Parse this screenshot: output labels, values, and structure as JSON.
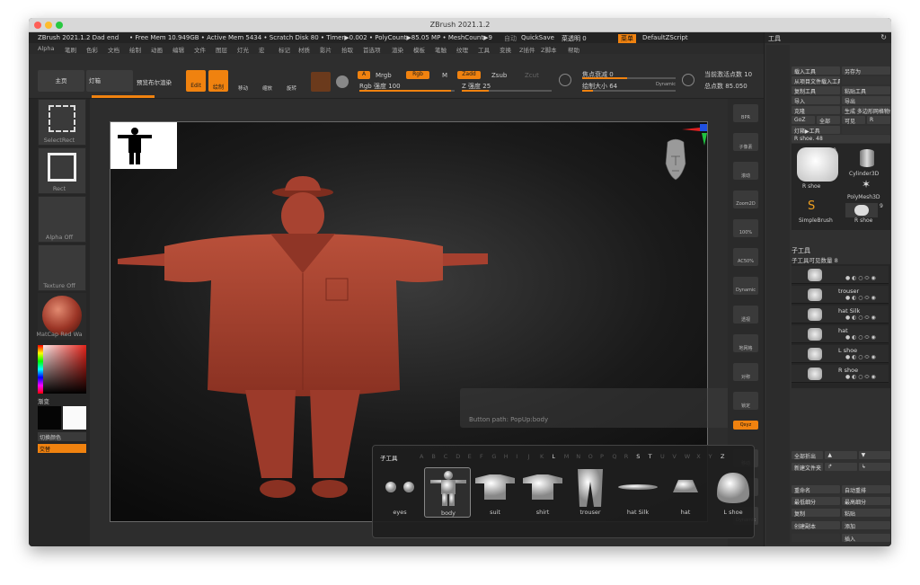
{
  "window": {
    "title": "ZBrush 2021.1.2"
  },
  "status": {
    "items": [
      "ZBrush 2021.1.2 Dad end",
      "• Free Mem 10.949GB • Active Mem 5434 • Scratch Disk 80 • Timer▶0.002 • PolyCount▶85.05 MP • MeshCount▶9"
    ],
    "right": [
      "自动",
      "QuickSave",
      "菜透明 0",
      "菜单",
      "DefaultZScript"
    ]
  },
  "menu": [
    "Alpha",
    "笔刷",
    "色彩",
    "文档",
    "绘制",
    "动画",
    "编辑",
    "文件",
    "图层",
    "灯光",
    "宏",
    "标记",
    "材质",
    "影片",
    "拾取",
    "首选项",
    "渲染",
    "模板",
    "笔触",
    "纹理",
    "工具",
    "变换",
    "Z插件",
    "Z脚本",
    "帮助"
  ],
  "topbar": {
    "home": "主页",
    "lightbox": "灯箱",
    "preview": "预览布尔渲染",
    "edit": "Edit",
    "draw": "绘制",
    "move": "移动",
    "scale": "缩放",
    "rotate": "旋转",
    "a": "A",
    "mrgb": "Mrgb",
    "rgb": "Rgb",
    "m": "M",
    "zadd": "Zadd",
    "zsub": "Zsub",
    "zcut": "Zcut",
    "rgb_intensity": "Rgb 强度 100",
    "z_intensity": "Z 强度 25",
    "focal": "焦点衰减 0",
    "draw_size": "绘制大小 64",
    "dynamic": "Dynamic",
    "active_points": "当前激活点数 10",
    "total_points": "总点数 85.050"
  },
  "leftshelf": {
    "select_rect": "SelectRect",
    "rect": "Rect",
    "alpha": "Alpha Off",
    "texture": "Texture Off",
    "material": "MatCap Red Wa",
    "gradient": "渐变",
    "switch_color": "切换颜色",
    "alternate": "交替"
  },
  "canvas": {
    "button_path": "Button path: PopUp:body"
  },
  "rightshelf": [
    "BPR",
    "子像素",
    "滚动",
    "Zoom2D",
    "100%",
    "AC50%",
    "Dynamic",
    "透视",
    "地网格",
    "对称",
    "锁定",
    "Qxyz",
    "移动",
    "缩放",
    "Dynamic"
  ],
  "panel": {
    "header": "工具",
    "buttons": [
      [
        "载入工具",
        "另存为"
      ],
      [
        "从项目文件载入工具",
        ""
      ],
      [
        "复制工具",
        "粘贴工具"
      ],
      [
        "导入",
        "导出"
      ],
      [
        "克隆",
        "生成 多边形网格物体"
      ],
      [
        "GoZ",
        "全部",
        "可见",
        "R"
      ],
      [
        "灯箱▶工具",
        ""
      ]
    ],
    "current": "R shoe. 48",
    "thumbs": [
      "R shoe",
      "Cylinder3D",
      "PolyMesh3D",
      "SimpleBrush",
      "R shoe"
    ],
    "thumb_badges": [
      "9",
      "9"
    ],
    "subtool_title": "子工具",
    "subtool_count": "子工具可见数量 8",
    "subtools": [
      "",
      "trouser",
      "hat Silk",
      "hat",
      "L shoe",
      "R shoe"
    ],
    "lower": [
      [
        "全部折出",
        "▲",
        "▼"
      ],
      [
        "新建文件夹",
        "↱",
        "↳"
      ],
      [
        "重命名",
        "自动重排"
      ],
      [
        "最低细分",
        "最高细分"
      ],
      [
        "复制",
        "粘贴"
      ],
      [
        "创建副本",
        "添加"
      ],
      [
        "",
        "插入"
      ]
    ]
  },
  "popup": {
    "title": "子工具",
    "letters": [
      "A",
      "B",
      "C",
      "D",
      "E",
      "F",
      "G",
      "H",
      "I",
      "J",
      "K",
      "L",
      "M",
      "N",
      "O",
      "P",
      "Q",
      "R",
      "S",
      "T",
      "U",
      "V",
      "W",
      "X",
      "Y",
      "Z"
    ],
    "items": [
      "eyes",
      "body",
      "suit",
      "shirt",
      "trouser",
      "hat Silk",
      "hat",
      "L shoe"
    ],
    "selected": 1
  },
  "colors": {
    "accent": "#f0820f",
    "model": "#a6402f"
  }
}
